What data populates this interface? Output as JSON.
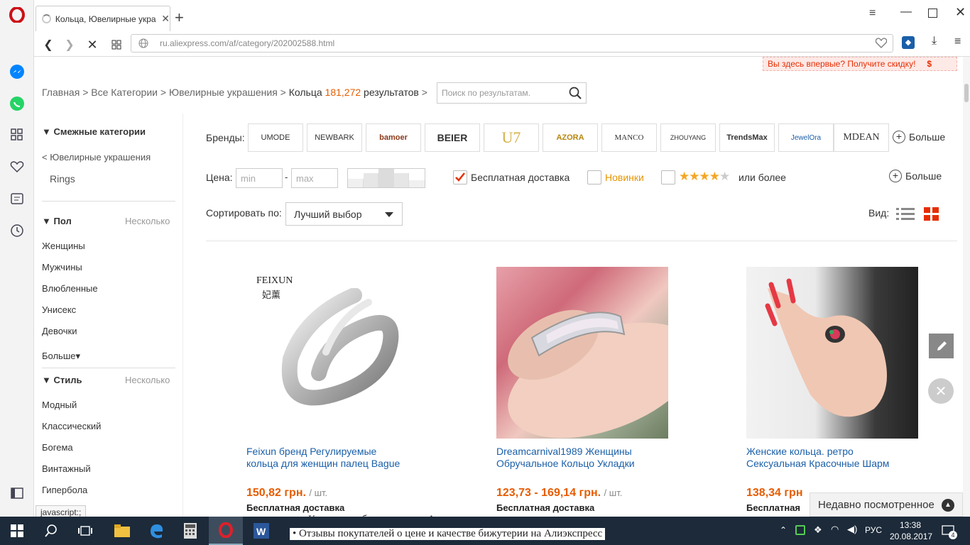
{
  "browser": {
    "tab_title": "Кольца, Ювелирные укра",
    "url_domain": "ru.aliexpress.com",
    "url_path": "/af/category/202002588.html",
    "promo_banner": "Вы здесь впервые? Получите скидку!",
    "promo_icon": "$"
  },
  "breadcrumb": {
    "home": "Главная",
    "sep": ">",
    "all": "Все Категории",
    "jewelry": "Ювелирные украшения",
    "current": "Кольца",
    "count": "181,272",
    "results": "результатов",
    "search_placeholder": "Поиск по результатам."
  },
  "sidebar": {
    "related_title": "Смежные категории",
    "parent_link": "< Ювелирные украшения",
    "sub": "Rings",
    "gender_title": "Пол",
    "multi": "Несколько",
    "gender_items": [
      "Женщины",
      "Мужчины",
      "Влюбленные",
      "Унисекс",
      "Девочки"
    ],
    "more": "Больше",
    "style_title": "Стиль",
    "style_items": [
      "Модный",
      "Классический",
      "Богема",
      "Винтажный",
      "Гипербола"
    ],
    "status_tooltip": "javascript:;"
  },
  "filters": {
    "brands_label": "Бренды:",
    "brands": [
      "UMODE",
      "NEWBARK",
      "bamoer",
      "BEIER",
      "U7",
      "AZORA",
      "MANCO",
      "ZHOUYANG",
      "TrendsMax",
      "JewelOra",
      "MDEAN"
    ],
    "brands_more": "Больше",
    "price_label": "Цена:",
    "price_min_placeholder": "min",
    "price_dash": "-",
    "price_max_placeholder": "max",
    "free_shipping": "Бесплатная доставка",
    "new_items": "Новинки",
    "rating_suffix": "или более",
    "rating_stars": 4,
    "more": "Больше",
    "sort_label": "Сортировать по:",
    "sort_value": "Лучший выбор",
    "view_label": "Вид:"
  },
  "products": [
    {
      "logo": "FEIXUN",
      "logo_cn": "妃薰",
      "title_line1": "Feixun бренд Регулируемые",
      "title_line2": "кольца для женщин палец Bague",
      "price": "150,82 грн.",
      "unit": "/ шт.",
      "shipping": "Бесплатная доставка"
    },
    {
      "title_line1": "Dreamcarnival1989 Женщины",
      "title_line2": "Обручальное Кольцо Укладки",
      "price": "123,73 - 169,14 грн.",
      "unit": "/ шт.",
      "shipping": "Бесплатная доставка"
    },
    {
      "title_line1": "Женские кольца. ретро",
      "title_line2": "Сексуальная Красочные Шарм",
      "price": "138,34 грн",
      "unit": "",
      "shipping": "Бесплатная"
    }
  ],
  "recently_viewed": "Недавно посмотренное",
  "background_text": {
    "line1": "Комплекты бижутерии на Алиэкспресс",
    "line2": "Отзывы покупателей о цене и качестве бижутерии на Алиэкспресс"
  },
  "taskbar": {
    "lang": "РУС",
    "time": "13:38",
    "date": "20.08.2017",
    "notif_count": "4"
  },
  "colors": {
    "accent": "#e62e04",
    "price": "#e65c00",
    "link": "#1a5fa8",
    "opera": "#cc0f16"
  }
}
